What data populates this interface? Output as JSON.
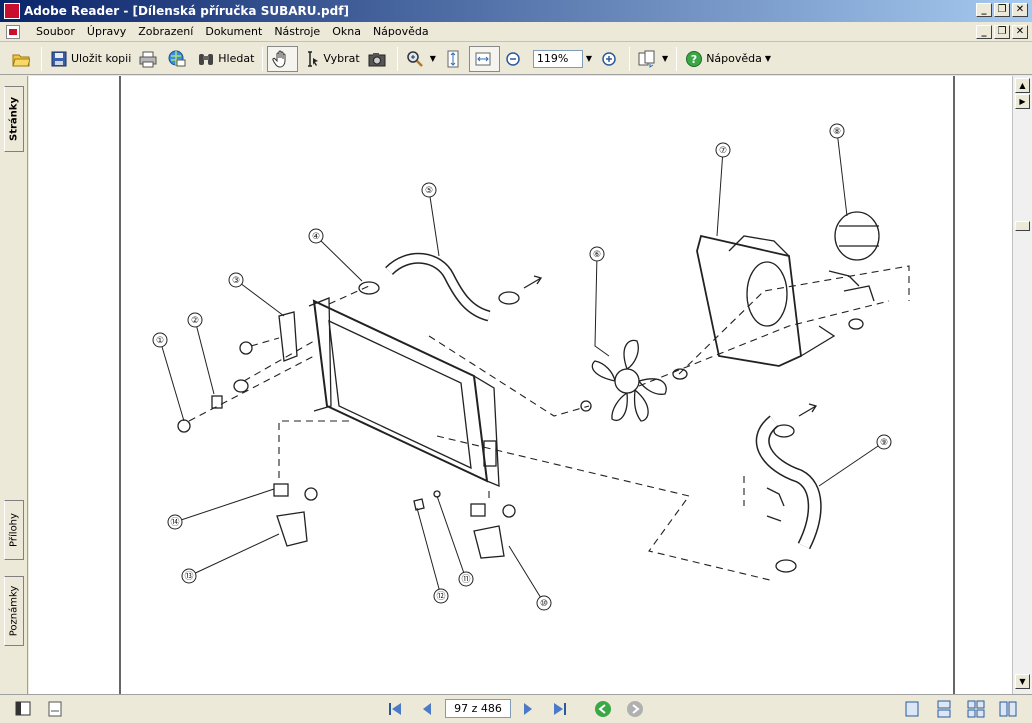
{
  "window": {
    "title": "Adobe Reader - [Dílenská příručka SUBARU.pdf]",
    "caption_minimize": "_",
    "caption_restore": "❐",
    "caption_close": "✕"
  },
  "menu": {
    "items": [
      "Soubor",
      "Úpravy",
      "Zobrazení",
      "Dokument",
      "Nástroje",
      "Okna",
      "Nápověda"
    ]
  },
  "toolbar": {
    "save_copy_label": "Uložit kopii",
    "search_label": "Hledat",
    "select_label": "Vybrat",
    "zoom_value": "119%",
    "help_label": "Nápověda"
  },
  "side_tabs": {
    "pages": "Stránky",
    "attachments": "Přílohy",
    "comments": "Poznámky"
  },
  "diagram": {
    "callouts": [
      "①",
      "②",
      "③",
      "④",
      "⑤",
      "⑥",
      "⑦",
      "⑧",
      "⑨",
      "⑩",
      "⑪",
      "⑫",
      "⑬",
      "⑭"
    ]
  },
  "status": {
    "page_indicator": "97 z 486"
  },
  "colors": {
    "title_bar_start": "#0a246a",
    "title_bar_end": "#a6caf0",
    "chrome": "#ece9d8",
    "accent_red": "#c8102e"
  }
}
